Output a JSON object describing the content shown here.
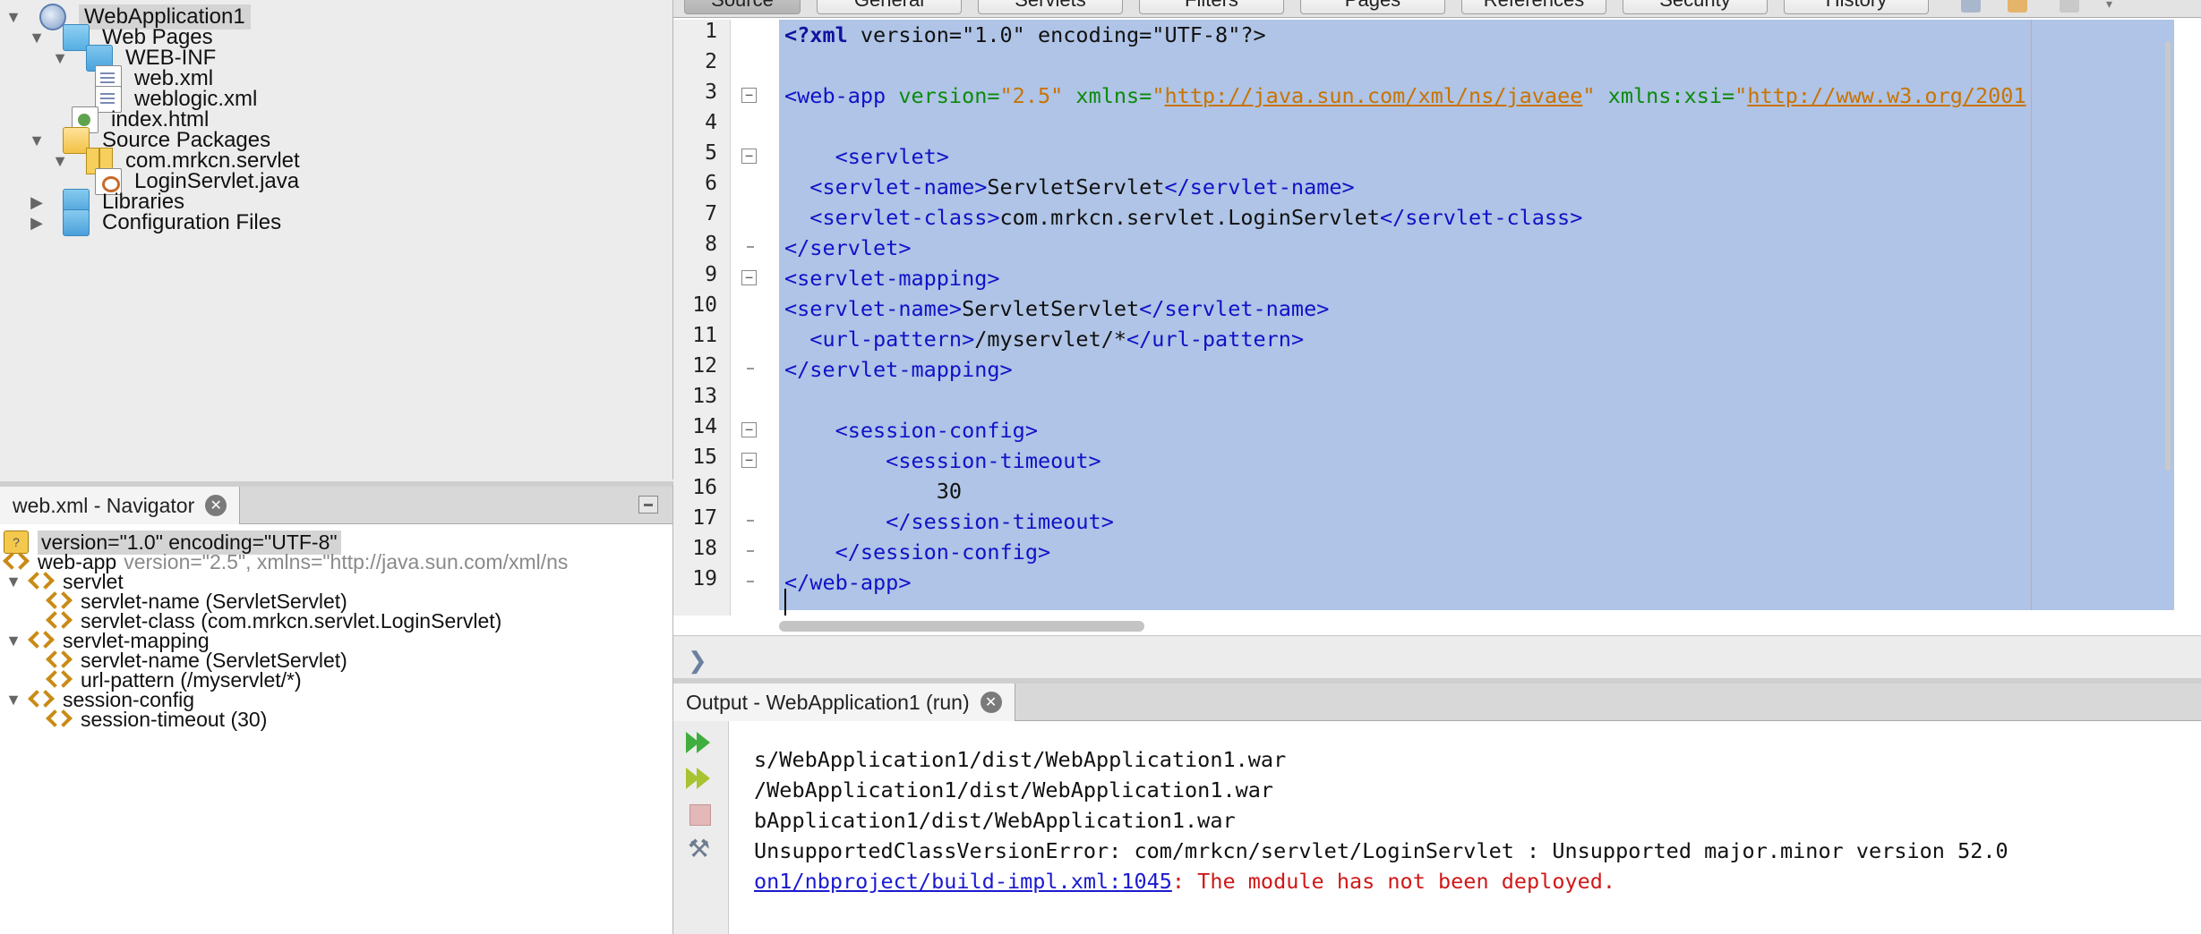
{
  "project": {
    "items": [
      {
        "label": "WebApplication1",
        "icon": "web-project-icon"
      },
      {
        "label": "Web Pages",
        "icon": "web-folder-icon"
      },
      {
        "label": "WEB-INF",
        "icon": "folder-icon"
      },
      {
        "label": "web.xml",
        "icon": "xml-file-icon"
      },
      {
        "label": "weblogic.xml",
        "icon": "xml-file-icon"
      },
      {
        "label": "index.html",
        "icon": "html-file-icon"
      },
      {
        "label": "Source Packages",
        "icon": "source-packages-icon"
      },
      {
        "label": "com.mrkcn.servlet",
        "icon": "package-icon"
      },
      {
        "label": "LoginServlet.java",
        "icon": "java-file-icon"
      },
      {
        "label": "Libraries",
        "icon": "libraries-icon"
      },
      {
        "label": "Configuration Files",
        "icon": "config-files-icon"
      }
    ]
  },
  "navigator": {
    "tab_title": "web.xml - Navigator",
    "items": [
      {
        "label": "version=\"1.0\" encoding=\"UTF-8\""
      },
      {
        "label": "web-app",
        "attrs": "version=\"2.5\", xmlns=\"http://java.sun.com/xml/ns"
      },
      {
        "label": "servlet"
      },
      {
        "label": "servlet-name (ServletServlet)"
      },
      {
        "label": "servlet-class (com.mrkcn.servlet.LoginServlet)"
      },
      {
        "label": "servlet-mapping"
      },
      {
        "label": "servlet-name (ServletServlet)"
      },
      {
        "label": "url-pattern (/myservlet/*)"
      },
      {
        "label": "session-config"
      },
      {
        "label": "session-timeout (30)"
      }
    ]
  },
  "editor": {
    "view_tabs": [
      "Source",
      "General",
      "Servlets",
      "Filters",
      "Pages",
      "References",
      "Security",
      "History"
    ],
    "line_numbers": [
      "1",
      "2",
      "3",
      "4",
      "5",
      "6",
      "7",
      "8",
      "9",
      "10",
      "11",
      "12",
      "13",
      "14",
      "15",
      "16",
      "17",
      "18",
      "19"
    ],
    "code": {
      "l1_pi": "<?xml",
      "l1_rest": " version=\"1.0\" encoding=\"UTF-8\"?>",
      "l3_open": "<web-app",
      "l3_attr1": " version=",
      "l3_val1": "\"2.5\"",
      "l3_attr2": " xmlns=",
      "l3_q1": "\"",
      "l3_url1": "http://java.sun.com/xml/ns/javaee",
      "l3_q2": "\"",
      "l3_attr3": " xmlns:xsi=",
      "l3_q3": "\"",
      "l3_url2": "http://www.w3.org/2001",
      "l5": "    <servlet>",
      "l6_open": "  <servlet-name>",
      "l6_text": "ServletServlet",
      "l6_close": "</servlet-name>",
      "l7_open": "  <servlet-class>",
      "l7_text": "com.mrkcn.servlet.LoginServlet",
      "l7_close": "</servlet-class>",
      "l8": "</servlet>",
      "l9": "<servlet-mapping>",
      "l10_open": "<servlet-name>",
      "l10_text": "ServletServlet",
      "l10_close": "</servlet-name>",
      "l11_open": "  <url-pattern>",
      "l11_text": "/myservlet/*",
      "l11_close": "</url-pattern>",
      "l12": "</servlet-mapping>",
      "l14": "    <session-config>",
      "l15": "        <session-timeout>",
      "l16": "            30",
      "l17": "        </session-timeout>",
      "l18": "    </session-config>",
      "l19": "</web-app>"
    }
  },
  "output": {
    "tab_title": "Output - WebApplication1 (run)",
    "lines": [
      "s/WebApplication1/dist/WebApplication1.war",
      "/WebApplication1/dist/WebApplication1.war",
      "bApplication1/dist/WebApplication1.war",
      "UnsupportedClassVersionError: com/mrkcn/servlet/LoginServlet : Unsupported major.minor version 52.0"
    ],
    "error_link": "on1/nbproject/build-impl.xml:1045",
    "error_message": ": The module has not been deployed."
  },
  "colors": {
    "selection": "#afc4e6",
    "xml_tag": "#1111c8",
    "xml_attr": "#0b8a0b",
    "xml_value": "#c97300",
    "error_text": "#d01818",
    "link": "#1a1ad1"
  }
}
